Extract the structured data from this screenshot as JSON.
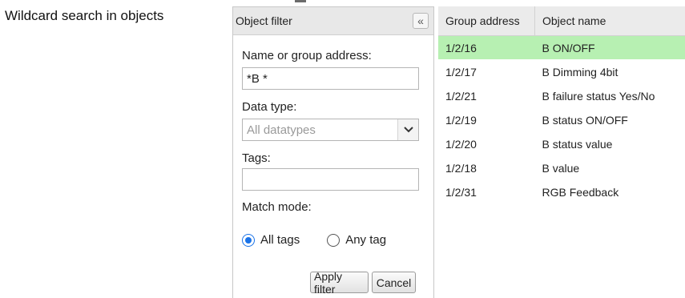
{
  "caption": "Wildcard search in objects",
  "filter_panel": {
    "title": "Object filter",
    "collapse_icon": "double-chevron-left-icon",
    "name_label": "Name or group address:",
    "name_value": "*B *",
    "datatype_label": "Data type:",
    "datatype_value": "All datatypes",
    "tags_label": "Tags:",
    "tags_value": "",
    "match_mode_label": "Match mode:",
    "match_options": [
      {
        "label": "All tags",
        "checked": true
      },
      {
        "label": "Any tag",
        "checked": false
      }
    ],
    "apply_label": "Apply filter",
    "cancel_label": "Cancel"
  },
  "table": {
    "headers": [
      "Group address",
      "Object name"
    ],
    "rows": [
      {
        "address": "1/2/16",
        "name": "B ON/OFF",
        "selected": true
      },
      {
        "address": "1/2/17",
        "name": "B Dimming 4bit",
        "selected": false
      },
      {
        "address": "1/2/21",
        "name": "B failure status Yes/No",
        "selected": false
      },
      {
        "address": "1/2/19",
        "name": "B status ON/OFF",
        "selected": false
      },
      {
        "address": "1/2/20",
        "name": "B status value",
        "selected": false
      },
      {
        "address": "1/2/18",
        "name": "B value",
        "selected": false
      },
      {
        "address": "1/2/31",
        "name": "RGB Feedback",
        "selected": false
      }
    ]
  },
  "colors": {
    "selected_row": "#b7f0b2",
    "radio_accent": "#1a73e8",
    "header_bg": "#e8e8e8"
  }
}
